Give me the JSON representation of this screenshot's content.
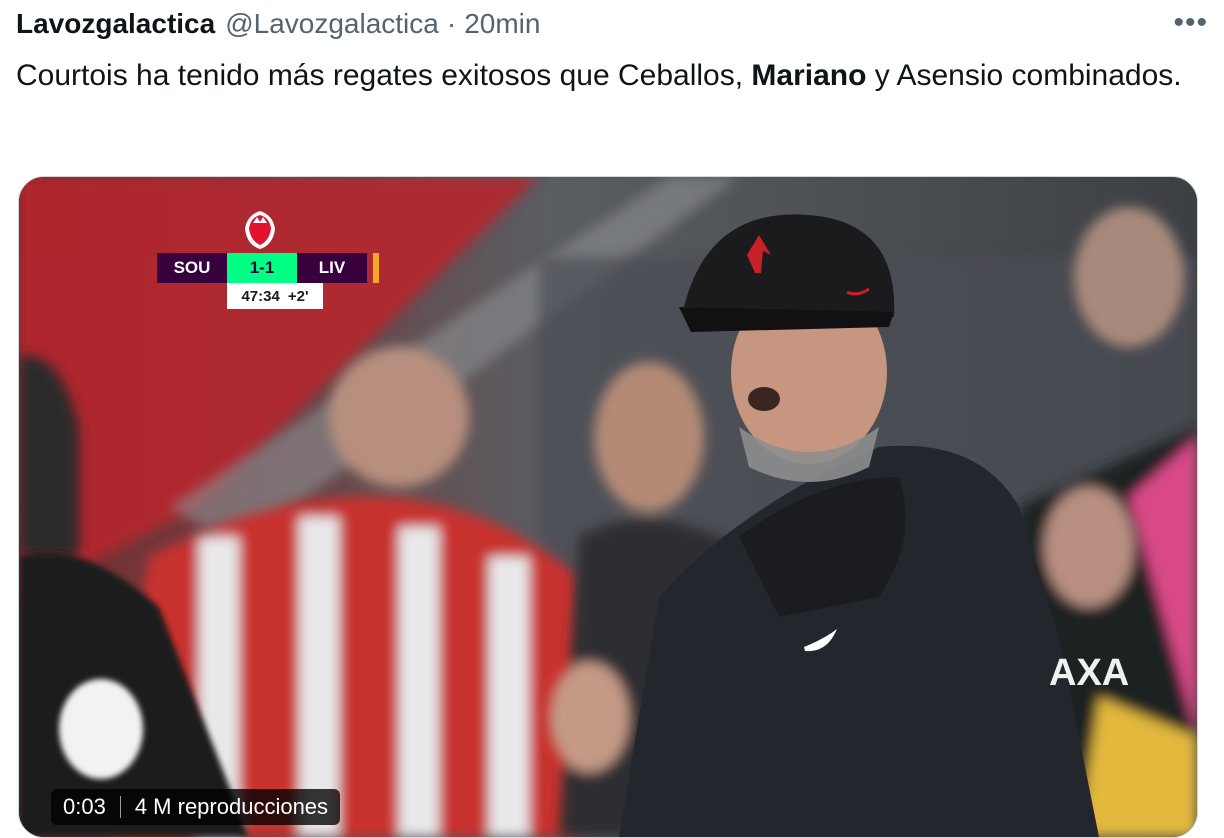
{
  "tweet": {
    "author_name": "Lavozgalactica",
    "handle": "@Lavozgalactica",
    "separator": "·",
    "time": "20min",
    "more_icon": "more-icon",
    "text_part1": "Courtois ha tenido más regates exitosos que Ceballos, ",
    "text_bold": "Mariano",
    "text_part2": " y Asensio combinados."
  },
  "video": {
    "scorebug": {
      "home_team": "SOU",
      "score": "1-1",
      "away_team": "LIV",
      "clock": "47:34",
      "added_time": "+2'",
      "home_color": "#38003c",
      "score_color": "#00ff85",
      "away_accent_color": "#f6a823"
    },
    "duration": "0:03",
    "views": "4 M reproducciones",
    "jacket_text": "AXA"
  }
}
